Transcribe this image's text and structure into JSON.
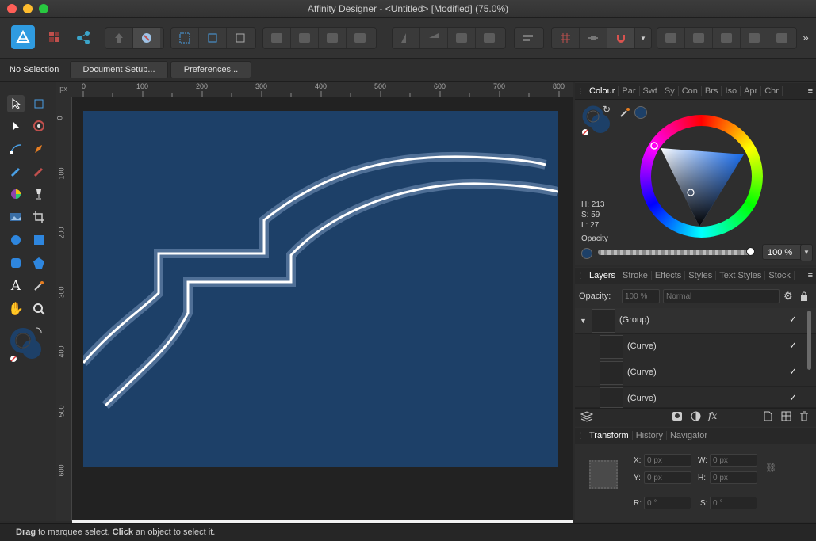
{
  "window": {
    "title": "Affinity Designer - <Untitled> [Modified] (75.0%)"
  },
  "context": {
    "selection": "No Selection",
    "document_setup": "Document Setup...",
    "preferences": "Preferences..."
  },
  "ruler": {
    "unit": "px",
    "h_ticks": [
      "0",
      "100",
      "200",
      "300",
      "400",
      "500",
      "600",
      "700",
      "800"
    ],
    "v_ticks": [
      "0",
      "100",
      "200",
      "300",
      "400",
      "500",
      "600"
    ]
  },
  "colour_panel": {
    "tabs": [
      "Colour",
      "Par",
      "Swt",
      "Sy",
      "Con",
      "Brs",
      "Iso",
      "Apr",
      "Chr"
    ],
    "h": "H: 213",
    "s": "S: 59",
    "l": "L: 27",
    "opacity_label": "Opacity",
    "opacity_value": "100 %",
    "fill_color": "#1d4068"
  },
  "layers_panel": {
    "tabs": [
      "Layers",
      "Stroke",
      "Effects",
      "Styles",
      "Text Styles",
      "Stock"
    ],
    "opacity_label": "Opacity:",
    "opacity_value": "100 %",
    "blend_mode": "Normal",
    "rows": [
      {
        "name": "(Group)"
      },
      {
        "name": "(Curve)"
      },
      {
        "name": "(Curve)"
      },
      {
        "name": "(Curve)"
      }
    ]
  },
  "transform_panel": {
    "tabs": [
      "Transform",
      "History",
      "Navigator"
    ],
    "x_label": "X:",
    "x_value": "0 px",
    "y_label": "Y:",
    "y_value": "0 px",
    "w_label": "W:",
    "w_value": "0 px",
    "h_label": "H:",
    "h_value": "0 px",
    "r_label": "R:",
    "r_value": "0 °",
    "s_label": "S:",
    "s_value": "0 °"
  },
  "status": {
    "drag": "Drag",
    "drag_text": " to marquee select. ",
    "click": "Click",
    "click_text": " an object to select it."
  }
}
